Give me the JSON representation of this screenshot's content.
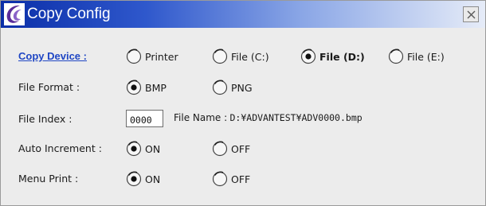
{
  "window": {
    "title": "Copy Config",
    "colors": {
      "title_start": "#0a2ea8",
      "title_end": "#e6ecf8",
      "link": "#1f46c4",
      "background": "#ececec"
    }
  },
  "copy_device": {
    "label": "Copy Device :",
    "options": [
      {
        "label": "Printer",
        "selected": false
      },
      {
        "label": "File (C:)",
        "selected": false
      },
      {
        "label": "File (D:)",
        "selected": true
      },
      {
        "label": "File (E:)",
        "selected": false
      }
    ]
  },
  "file_format": {
    "label": "File Format :",
    "options": [
      {
        "label": "BMP",
        "selected": true
      },
      {
        "label": "PNG",
        "selected": false
      }
    ]
  },
  "file_index": {
    "label": "File Index :",
    "value": "0000",
    "file_name_label": "File Name :",
    "file_name_value": "D:¥ADVANTEST¥ADV0000.bmp"
  },
  "auto_increment": {
    "label": "Auto Increment :",
    "options": [
      {
        "label": "ON",
        "selected": true
      },
      {
        "label": "OFF",
        "selected": false
      }
    ]
  },
  "menu_print": {
    "label": "Menu Print :",
    "options": [
      {
        "label": "ON",
        "selected": true
      },
      {
        "label": "OFF",
        "selected": false
      }
    ]
  }
}
